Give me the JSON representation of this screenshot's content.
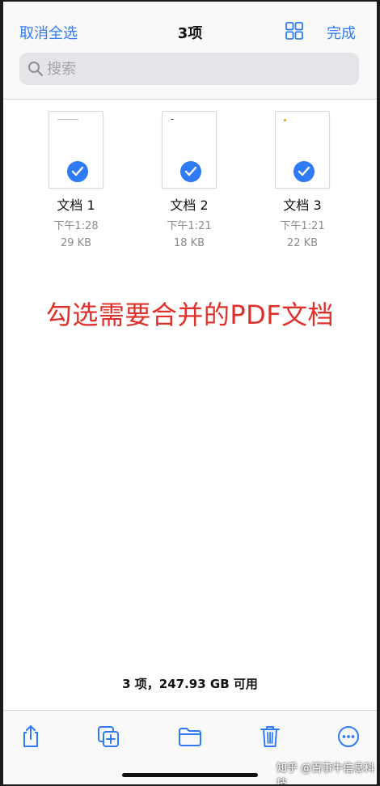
{
  "nav": {
    "cancel_select_all": "取消全选",
    "title": "3项",
    "done": "完成",
    "grid_icon": "grid-view-icon"
  },
  "search": {
    "placeholder": "搜索",
    "icon": "search-icon"
  },
  "files": [
    {
      "name": "文档 1",
      "time": "下午1:28",
      "size": "29 KB",
      "selected": true
    },
    {
      "name": "文档 2",
      "time": "下午1:21",
      "size": "18 KB",
      "selected": true
    },
    {
      "name": "文档 3",
      "time": "下午1:21",
      "size": "22 KB",
      "selected": true
    }
  ],
  "annotation": "勾选需要合并的PDF文档",
  "status": "3 项，247.93 GB 可用",
  "toolbar": {
    "buttons": [
      "share-icon",
      "duplicate-icon",
      "move-folder-icon",
      "trash-icon",
      "more-icon"
    ]
  },
  "watermark": "知乎 @百事牛信息科技",
  "colors": {
    "accent": "#2f7bf5",
    "annotation": "#e0302a"
  }
}
